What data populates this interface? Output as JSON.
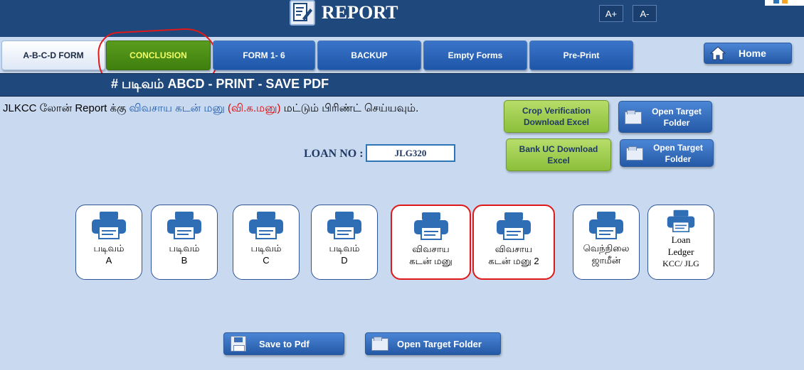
{
  "header": {
    "title": "REPORT",
    "font_increase_label": "A+",
    "font_decrease_label": "A-",
    "icon": "report-icon"
  },
  "tabs": [
    {
      "label": "A-B-C-D FORM",
      "state": "active"
    },
    {
      "label": "CONCLUSION",
      "state": "highlighted"
    },
    {
      "label": "FORM 1- 6",
      "state": "normal"
    },
    {
      "label": "BACKUP",
      "state": "normal"
    },
    {
      "label": "Empty Forms",
      "state": "normal"
    },
    {
      "label": "Pre-Print",
      "state": "normal"
    }
  ],
  "home_button": {
    "label": "Home",
    "icon": "home-icon"
  },
  "section_title": "#  படிவம்  ABCD - PRINT - SAVE PDF",
  "description": {
    "part1": "JLKCC லோன் Report க்கு ",
    "part2": "விவசாய கடன் மனு",
    "part3": " (வி.க.மனு)",
    "part4": " மட்டும் பிரிண்ட் செய்யவும்."
  },
  "actions": {
    "crop_verification": "Crop Verification Download Excel",
    "bank_uc": "Bank UC  Download Excel",
    "open_target_1": "Open Target Folder",
    "open_target_2": "Open Target Folder"
  },
  "loan": {
    "label": "LOAN NO :",
    "value": "JLG320"
  },
  "print_cards": [
    {
      "line1": "படிவம்",
      "line2": "A",
      "highlighted": false
    },
    {
      "line1": "படிவம்",
      "line2": "B",
      "highlighted": false
    },
    {
      "line1": "படிவம்",
      "line2": "C",
      "highlighted": false
    },
    {
      "line1": "படிவம்",
      "line2": "D",
      "highlighted": false
    },
    {
      "line1": "விவசாய",
      "line2": "கடன் மனு",
      "highlighted": true
    },
    {
      "line1": "விவசாய",
      "line2": "கடன் மனு 2",
      "highlighted": true
    },
    {
      "line1": "வெந்நிலை",
      "line2": "ஜாமீன்",
      "highlighted": false
    },
    {
      "line1": "Loan",
      "line2": "Ledger",
      "line3": "KCC/ JLG",
      "highlighted": false
    }
  ],
  "bottom": {
    "save_pdf": "Save to Pdf",
    "open_target": "Open Target Folder"
  },
  "colors": {
    "header_bg": "#1f497d",
    "page_bg": "#c9daf0",
    "tab_blue": "#2e66b8",
    "tab_green": "#4a8c16",
    "highlight_red": "#e11818",
    "action_green": "#9fcd4f"
  }
}
